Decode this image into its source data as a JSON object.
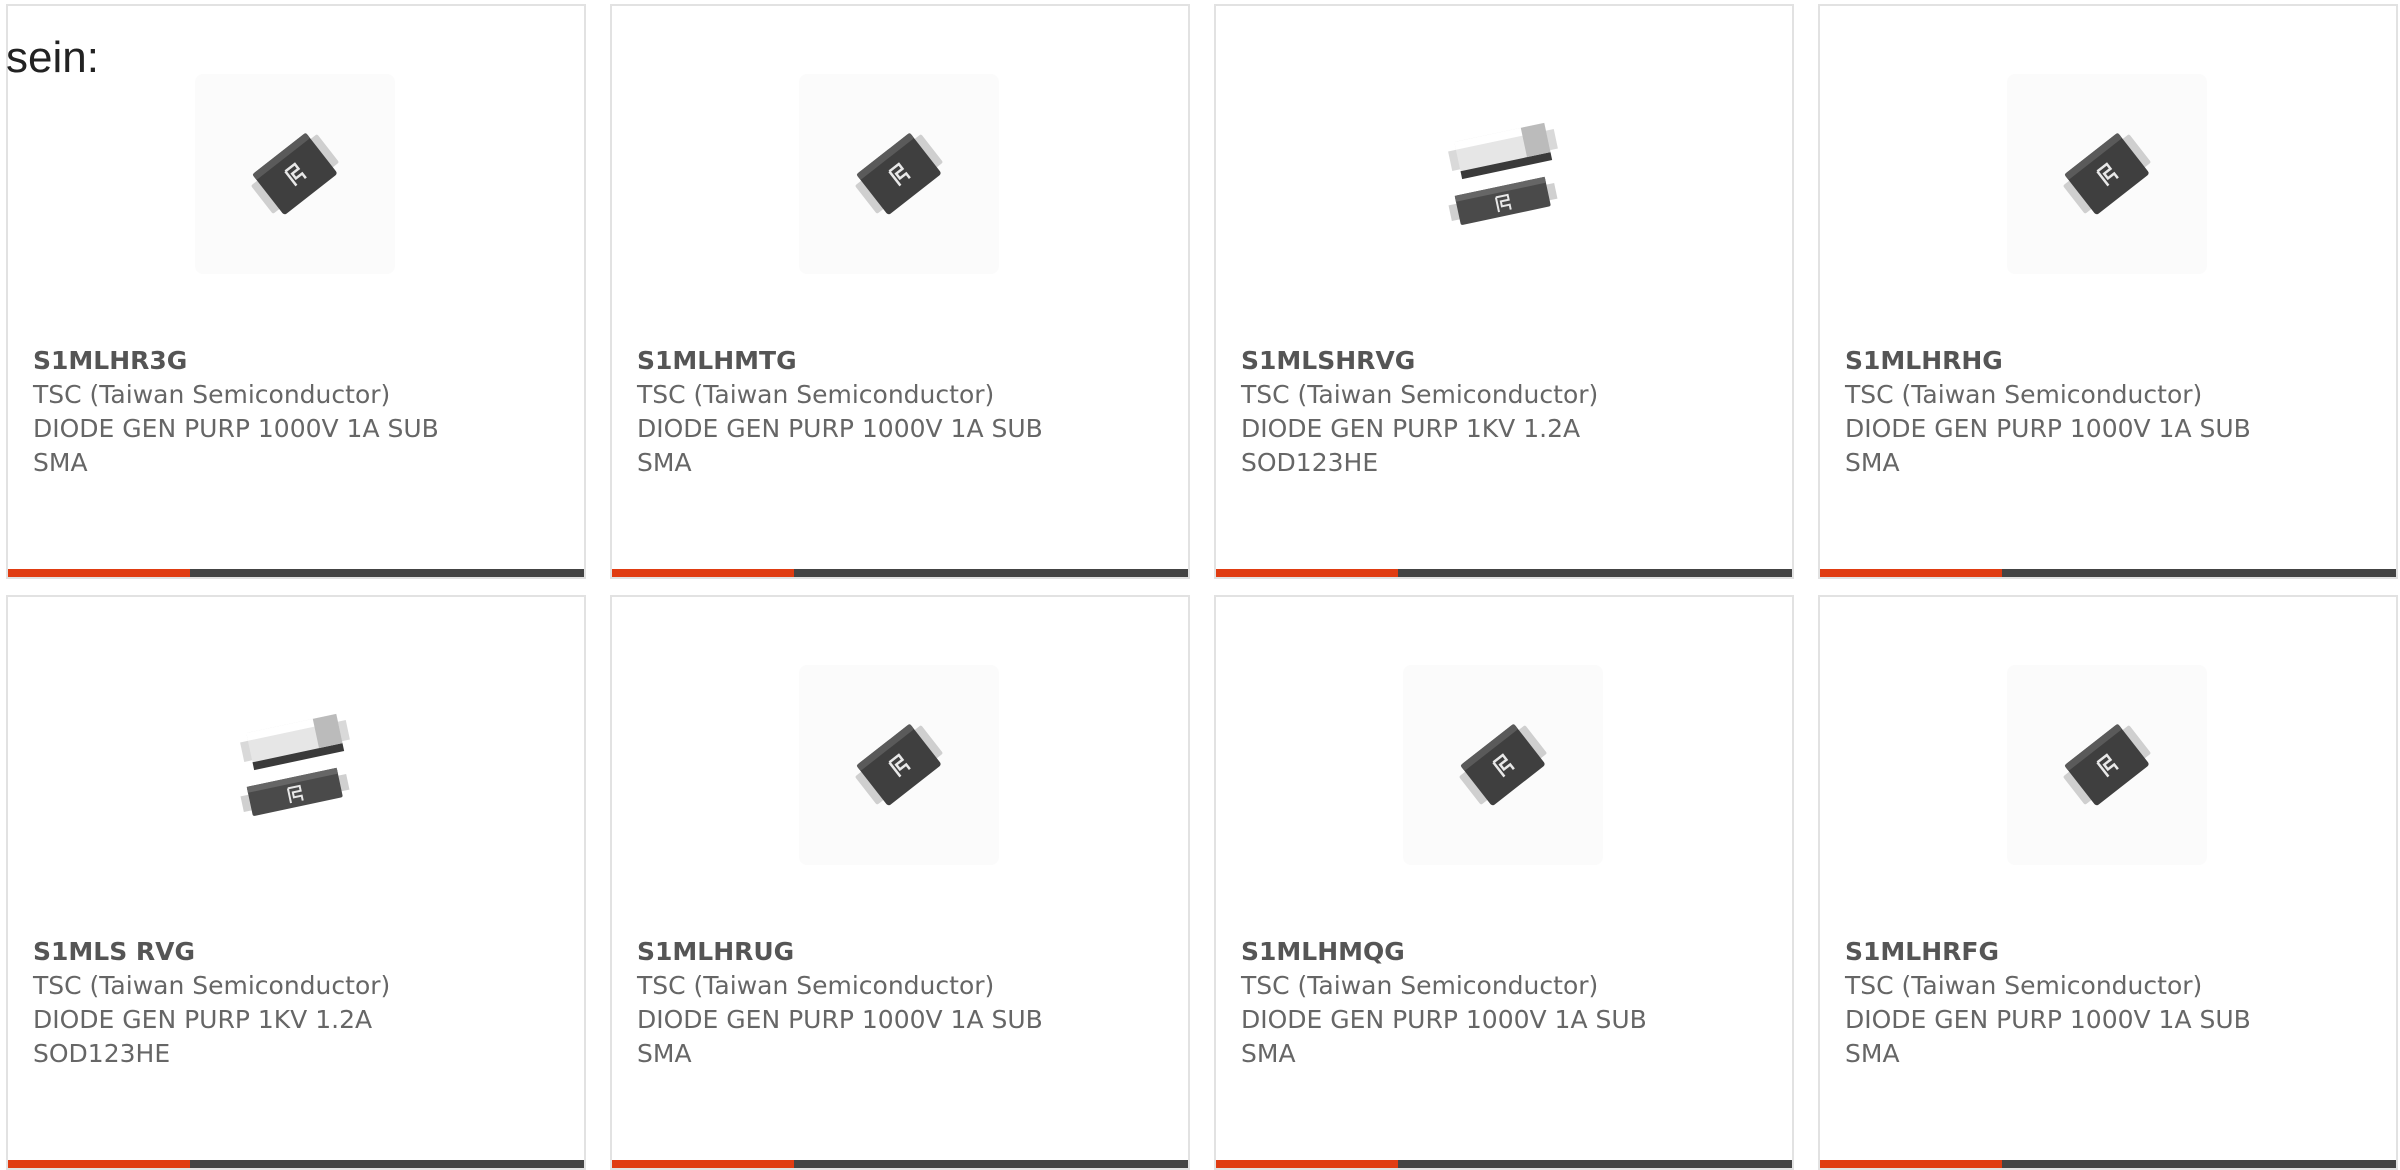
{
  "intro_text": "sein:",
  "colors": {
    "accent": "#e03c12",
    "bar_dark": "#444444",
    "card_border": "#e2e2e2"
  },
  "products": [
    {
      "mpn": "S1MLHR3G",
      "manufacturer": "TSC (Taiwan Semiconductor)",
      "description": "DIODE GEN PURP 1000V 1A SUB SMA",
      "image_icon": "sma-diode-icon"
    },
    {
      "mpn": "S1MLHMTG",
      "manufacturer": "TSC (Taiwan Semiconductor)",
      "description": "DIODE GEN PURP 1000V 1A SUB SMA",
      "image_icon": "sma-diode-icon"
    },
    {
      "mpn": "S1MLSHRVG",
      "manufacturer": "TSC (Taiwan Semiconductor)",
      "description": "DIODE GEN PURP 1KV 1.2A SOD123HE",
      "image_icon": "sod123he-diode-icon"
    },
    {
      "mpn": "S1MLHRHG",
      "manufacturer": "TSC (Taiwan Semiconductor)",
      "description": "DIODE GEN PURP 1000V 1A SUB SMA",
      "image_icon": "sma-diode-icon"
    },
    {
      "mpn": "S1MLS RVG",
      "manufacturer": "TSC (Taiwan Semiconductor)",
      "description": "DIODE GEN PURP 1KV 1.2A SOD123HE",
      "image_icon": "sod123he-diode-icon"
    },
    {
      "mpn": "S1MLHRUG",
      "manufacturer": "TSC (Taiwan Semiconductor)",
      "description": "DIODE GEN PURP 1000V 1A SUB SMA",
      "image_icon": "sma-diode-icon"
    },
    {
      "mpn": "S1MLHMQG",
      "manufacturer": "TSC (Taiwan Semiconductor)",
      "description": "DIODE GEN PURP 1000V 1A SUB SMA",
      "image_icon": "sma-diode-icon"
    },
    {
      "mpn": "S1MLHRFG",
      "manufacturer": "TSC (Taiwan Semiconductor)",
      "description": "DIODE GEN PURP 1000V 1A SUB SMA",
      "image_icon": "sma-diode-icon"
    }
  ]
}
